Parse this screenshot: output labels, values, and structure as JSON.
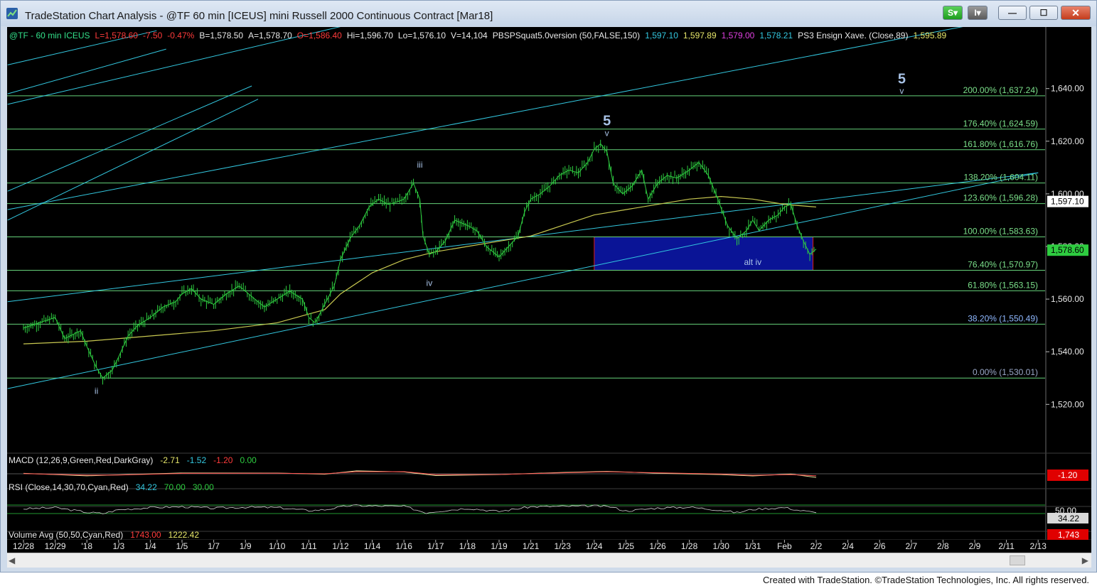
{
  "window": {
    "title": "TradeStation Chart Analysis - @TF 60 min [ICEUS] mini Russell 2000 Continuous Contract [Mar18]",
    "buttons": {
      "s": "S",
      "i": "I",
      "minimize": "—",
      "maximize": "☐",
      "close": "✕"
    }
  },
  "footer": "Created with TradeStation. ©TradeStation Technologies, Inc. All rights reserved.",
  "colors": {
    "background": "#000000",
    "price": "#2ecc40",
    "ma": "#c8c850",
    "channel": "#33c8e0",
    "fib": "#66d27a",
    "box": "#0a1496",
    "box_border": "#dc1e1e",
    "wave_label": "#a8c2e6"
  },
  "header": [
    {
      "text": "@TF - 60 min  ICEUS",
      "color": "#33e08a"
    },
    {
      "text": "L=1,578.60",
      "color": "#ff3b3b"
    },
    {
      "text": "-7.50",
      "color": "#ff3b3b"
    },
    {
      "text": "-0.47%",
      "color": "#ff3b3b"
    },
    {
      "text": "B=1,578.50",
      "color": "#e8e8e8"
    },
    {
      "text": "A=1,578.70",
      "color": "#e8e8e8"
    },
    {
      "text": "O=1,586.40",
      "color": "#ff3b3b"
    },
    {
      "text": "Hi=1,596.70",
      "color": "#e8e8e8"
    },
    {
      "text": "Lo=1,576.10",
      "color": "#e8e8e8"
    },
    {
      "text": "V=14,104",
      "color": "#e8e8e8"
    },
    {
      "text": "PBSPSquat5.0version (50,FALSE,150)",
      "color": "#e8e8e8"
    },
    {
      "text": "1,597.10",
      "color": "#33c8e0"
    },
    {
      "text": "1,597.89",
      "color": "#e6e66a"
    },
    {
      "text": "1,579.00",
      "color": "#e040e0"
    },
    {
      "text": "1,578.21",
      "color": "#33c8e0"
    },
    {
      "text": "PS3 Ensign Xave. (Close,89)",
      "color": "#e8e8e8"
    },
    {
      "text": "1,595.89",
      "color": "#e6e66a"
    }
  ],
  "chart_data": [
    {
      "type": "line",
      "title": "@TF - 60 min ICEUS",
      "x_ticks": [
        "12/28",
        "12/29",
        "'18",
        "1/3",
        "1/4",
        "1/5",
        "1/7",
        "1/9",
        "1/10",
        "1/11",
        "1/12",
        "1/14",
        "1/16",
        "1/17",
        "1/18",
        "1/19",
        "1/21",
        "1/23",
        "1/24",
        "1/25",
        "1/26",
        "1/28",
        "1/30",
        "1/31",
        "Feb",
        "2/2",
        "2/4",
        "2/6",
        "2/7",
        "2/8",
        "2/9",
        "2/11",
        "2/13"
      ],
      "ylim": [
        1502,
        1658
      ],
      "y_ticks": [
        "1,520.00",
        "1,540.00",
        "1,560.00",
        "1,580.00",
        "1,600.00",
        "1,620.00",
        "1,640.00"
      ],
      "y_tick_values": [
        1520,
        1540,
        1560,
        1580,
        1600,
        1620,
        1640
      ],
      "series": [
        {
          "name": "@TF 60 min",
          "points": [
            [
              0,
              1549
            ],
            [
              1,
              1553
            ],
            [
              1.3,
              1545
            ],
            [
              1.8,
              1548
            ],
            [
              2,
              1542
            ],
            [
              2.3,
              1534
            ],
            [
              2.5,
              1530
            ],
            [
              2.8,
              1533
            ],
            [
              3,
              1538
            ],
            [
              3.3,
              1546
            ],
            [
              3.6,
              1550
            ],
            [
              4,
              1553
            ],
            [
              4.4,
              1557
            ],
            [
              4.8,
              1559
            ],
            [
              5,
              1562
            ],
            [
              5.3,
              1564
            ],
            [
              5.6,
              1560
            ],
            [
              6,
              1558
            ],
            [
              6.4,
              1562
            ],
            [
              6.8,
              1565
            ],
            [
              7,
              1563
            ],
            [
              7.3,
              1560
            ],
            [
              7.6,
              1557
            ],
            [
              8,
              1560
            ],
            [
              8.4,
              1563
            ],
            [
              8.8,
              1560
            ],
            [
              9,
              1553
            ],
            [
              9.2,
              1551
            ],
            [
              9.5,
              1558
            ],
            [
              9.8,
              1565
            ],
            [
              10,
              1575
            ],
            [
              10.3,
              1583
            ],
            [
              10.6,
              1588
            ],
            [
              10.9,
              1595
            ],
            [
              11.2,
              1598
            ],
            [
              11.5,
              1596
            ],
            [
              11.8,
              1597
            ],
            [
              12,
              1598
            ],
            [
              12.3,
              1604
            ],
            [
              12.5,
              1598
            ],
            [
              12.6,
              1584
            ],
            [
              12.8,
              1577
            ],
            [
              13,
              1578
            ],
            [
              13.3,
              1582
            ],
            [
              13.6,
              1590
            ],
            [
              14,
              1588
            ],
            [
              14.3,
              1586
            ],
            [
              14.6,
              1580
            ],
            [
              15,
              1576
            ],
            [
              15.3,
              1580
            ],
            [
              15.6,
              1584
            ],
            [
              15.8,
              1593
            ],
            [
              16,
              1598
            ],
            [
              16.3,
              1600
            ],
            [
              16.6,
              1603
            ],
            [
              16.9,
              1607
            ],
            [
              17.2,
              1609
            ],
            [
              17.5,
              1608
            ],
            [
              17.8,
              1612
            ],
            [
              18,
              1617
            ],
            [
              18.2,
              1619
            ],
            [
              18.4,
              1616
            ],
            [
              18.6,
              1604
            ],
            [
              18.9,
              1600
            ],
            [
              19.2,
              1603
            ],
            [
              19.5,
              1609
            ],
            [
              19.7,
              1598
            ],
            [
              20,
              1604
            ],
            [
              20.3,
              1607
            ],
            [
              20.6,
              1606
            ],
            [
              21,
              1609
            ],
            [
              21.3,
              1612
            ],
            [
              21.6,
              1607
            ],
            [
              21.9,
              1598
            ],
            [
              22.2,
              1588
            ],
            [
              22.5,
              1583
            ],
            [
              22.8,
              1586
            ],
            [
              23,
              1590
            ],
            [
              23.2,
              1586
            ],
            [
              23.5,
              1590
            ],
            [
              23.8,
              1592
            ],
            [
              24,
              1595
            ],
            [
              24.2,
              1596
            ],
            [
              24.4,
              1588
            ],
            [
              24.6,
              1582
            ],
            [
              24.8,
              1577
            ],
            [
              25,
              1579
            ]
          ]
        },
        {
          "name": "PS3 Ensign Xave. (Close,89)",
          "points": [
            [
              0,
              1543
            ],
            [
              2,
              1544
            ],
            [
              4,
              1546
            ],
            [
              6,
              1548
            ],
            [
              8,
              1551
            ],
            [
              9.5,
              1556
            ],
            [
              10,
              1562
            ],
            [
              11,
              1570
            ],
            [
              12,
              1575
            ],
            [
              13,
              1578
            ],
            [
              14,
              1580
            ],
            [
              15,
              1582
            ],
            [
              16,
              1584
            ],
            [
              17,
              1588
            ],
            [
              18,
              1592
            ],
            [
              19,
              1594
            ],
            [
              20,
              1596
            ],
            [
              21,
              1598
            ],
            [
              22,
              1599
            ],
            [
              23,
              1598
            ],
            [
              24,
              1596
            ],
            [
              25,
              1595
            ]
          ]
        }
      ],
      "fib_levels": [
        {
          "label": "200.00% (1,637.24)",
          "value": 1637.24
        },
        {
          "label": "176.40% (1,624.59)",
          "value": 1624.59
        },
        {
          "label": "161.80% (1,616.76)",
          "value": 1616.76
        },
        {
          "label": "138.20% (1,604.11)",
          "value": 1604.11
        },
        {
          "label": "123.60% (1,596.28)",
          "value": 1596.28
        },
        {
          "label": "100.00% (1,583.63)",
          "value": 1583.63
        },
        {
          "label": "76.40% (1,570.97)",
          "value": 1570.97
        },
        {
          "label": "61.80% (1,563.15)",
          "value": 1563.15
        },
        {
          "label": "38.20% (1,550.49)",
          "value": 1550.49
        },
        {
          "label": "0.00% (1,530.01)",
          "value": 1530.01
        }
      ],
      "target_box": {
        "x1": 18,
        "x2": 24.9,
        "y1": 1583.63,
        "y2": 1570.97,
        "label": "alt iv",
        "label_at": [
          23,
          1573
        ]
      },
      "channel_lines": [
        [
          [
            -0.5,
            1526
          ],
          [
            32,
            1608
          ]
        ],
        [
          [
            -0.5,
            1594
          ],
          [
            32,
            1669
          ]
        ],
        [
          [
            -0.5,
            1559
          ],
          [
            32,
            1608
          ]
        ],
        [
          [
            -0.5,
            1649
          ],
          [
            4.2,
            1662
          ]
        ],
        [
          [
            -0.5,
            1638
          ],
          [
            4.5,
            1655
          ]
        ],
        [
          [
            -0.5,
            1634
          ],
          [
            12.3,
            1670
          ]
        ],
        [
          [
            -0.5,
            1601
          ],
          [
            7.2,
            1641
          ]
        ],
        [
          [
            -0.5,
            1590
          ],
          [
            7.4,
            1636
          ]
        ]
      ],
      "wave_labels": [
        {
          "text": "ii",
          "x": 2.3,
          "y": 1524
        },
        {
          "text": "iii",
          "x": 12.5,
          "y": 1610
        },
        {
          "text": "iv",
          "x": 12.8,
          "y": 1565
        },
        {
          "text": "5",
          "x": 18.4,
          "y": 1626,
          "big": true
        },
        {
          "text": "v",
          "x": 18.4,
          "y": 1622
        },
        {
          "text": "5",
          "x": 27.7,
          "y": 1642,
          "big": true
        },
        {
          "text": "v",
          "x": 27.7,
          "y": 1638
        }
      ],
      "last_price_tags": [
        {
          "text": "1,597.10",
          "value": 1597.1,
          "bg": "#ffffff",
          "color": "#000000"
        },
        {
          "text": "1,578.60",
          "value": 1578.6,
          "bg": "#2ecc40",
          "color": "#000000"
        }
      ]
    },
    {
      "type": "line",
      "title": "MACD (12,26,9,Green,Red,DarkGray)",
      "legend_values": [
        "-2.71",
        "-1.52",
        "-1.20",
        "0.00"
      ],
      "last_value_tag": "-1.20",
      "ylim": [
        -10,
        10
      ],
      "series": [
        {
          "name": "MACD",
          "points": [
            [
              0,
              0.3
            ],
            [
              2,
              -1.5
            ],
            [
              3,
              -0.8
            ],
            [
              5,
              0.6
            ],
            [
              8,
              0.5
            ],
            [
              9.5,
              -0.3
            ],
            [
              10.5,
              2.2
            ],
            [
              12,
              1.4
            ],
            [
              13,
              -1.3
            ],
            [
              15,
              -0.6
            ],
            [
              17,
              1.0
            ],
            [
              18.4,
              1.8
            ],
            [
              20,
              0.4
            ],
            [
              22,
              -0.6
            ],
            [
              23,
              -1.6
            ],
            [
              24.2,
              -0.2
            ],
            [
              25,
              -2.7
            ]
          ]
        },
        {
          "name": "Signal",
          "points": [
            [
              0,
              0.1
            ],
            [
              2,
              -1.0
            ],
            [
              3,
              -0.9
            ],
            [
              5,
              0.3
            ],
            [
              8,
              0.4
            ],
            [
              9.5,
              0.0
            ],
            [
              10.5,
              1.5
            ],
            [
              12,
              1.6
            ],
            [
              13,
              -0.6
            ],
            [
              15,
              -0.5
            ],
            [
              17,
              0.7
            ],
            [
              18.4,
              1.5
            ],
            [
              20,
              0.7
            ],
            [
              22,
              -0.2
            ],
            [
              23,
              -1.1
            ],
            [
              24.2,
              -0.6
            ],
            [
              25,
              -1.5
            ]
          ]
        }
      ]
    },
    {
      "type": "line",
      "title": "RSI (Close,14,30,70,Cyan,Red)",
      "legend_values": [
        "34.22",
        "70.00",
        "30.00"
      ],
      "axis_tag": "50.00",
      "last_value_tag": "34.22",
      "ylim": [
        0,
        100
      ],
      "levels": [
        70,
        30
      ],
      "series": [
        {
          "name": "RSI",
          "points": [
            [
              0,
              52
            ],
            [
              1,
              58
            ],
            [
              2,
              36
            ],
            [
              2.5,
              30
            ],
            [
              3,
              48
            ],
            [
              4,
              58
            ],
            [
              5,
              62
            ],
            [
              6,
              55
            ],
            [
              7,
              60
            ],
            [
              8,
              58
            ],
            [
              9,
              44
            ],
            [
              9.5,
              48
            ],
            [
              10.3,
              68
            ],
            [
              11,
              66
            ],
            [
              12,
              64
            ],
            [
              12.7,
              34
            ],
            [
              13,
              40
            ],
            [
              14,
              55
            ],
            [
              15,
              40
            ],
            [
              16,
              62
            ],
            [
              17,
              64
            ],
            [
              18,
              66
            ],
            [
              18.5,
              62
            ],
            [
              19,
              42
            ],
            [
              20,
              56
            ],
            [
              21,
              60
            ],
            [
              22,
              46
            ],
            [
              22.5,
              34
            ],
            [
              23,
              50
            ],
            [
              24,
              58
            ],
            [
              24.5,
              44
            ],
            [
              25,
              34
            ]
          ]
        }
      ]
    },
    {
      "type": "bar",
      "title": "Volume Avg (50,50,Cyan,Red)",
      "legend_values": [
        "1743.00",
        "1222.42"
      ],
      "last_value_tag": "1,743"
    }
  ]
}
